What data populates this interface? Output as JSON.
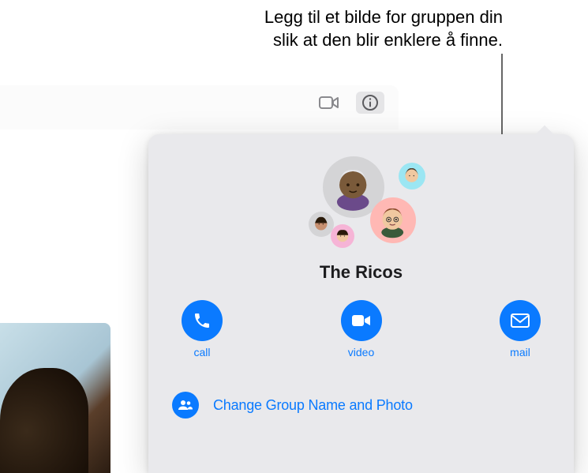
{
  "caption": {
    "line1": "Legg til et bilde for gruppen din",
    "line2": "slik at den blir enklere å finne."
  },
  "toolbar": {
    "facetime_icon": "video-icon",
    "info_icon": "info-icon"
  },
  "panel": {
    "group_name": "The Ricos",
    "actions": {
      "call": {
        "label": "call"
      },
      "video": {
        "label": "video"
      },
      "mail": {
        "label": "mail"
      }
    },
    "change_group": {
      "label": "Change Group Name and Photo"
    },
    "avatars": [
      {
        "id": "member-1"
      },
      {
        "id": "member-2"
      },
      {
        "id": "member-3"
      },
      {
        "id": "member-4"
      },
      {
        "id": "member-5"
      }
    ]
  },
  "colors": {
    "accent_blue": "#0a7aff",
    "panel_bg": "#e9e9ec"
  }
}
